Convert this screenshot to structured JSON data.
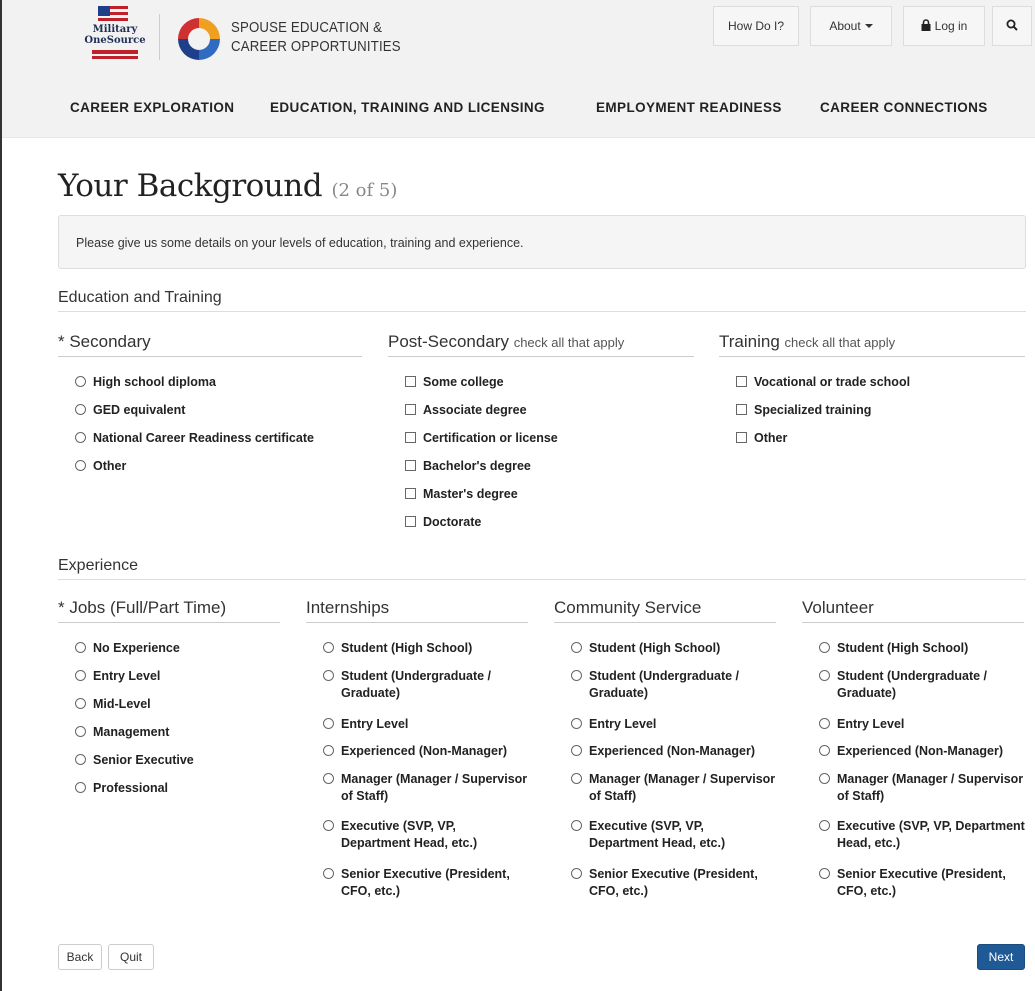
{
  "header": {
    "mos_logo_text": "Military OneSource",
    "seco_line1": "SPOUSE EDUCATION &",
    "seco_line2": "CAREER OPPORTUNITIES",
    "how_do_i": "How Do I?",
    "about": "About",
    "login": "Log in"
  },
  "nav": {
    "items": [
      "CAREER EXPLORATION",
      "EDUCATION, TRAINING AND LICENSING",
      "EMPLOYMENT READINESS",
      "CAREER CONNECTIONS"
    ]
  },
  "page": {
    "title": "Your Background",
    "step": "(2 of 5)",
    "intro": "Please give us some details on your levels of education, training and experience."
  },
  "education": {
    "heading": "Education and Training",
    "secondary": {
      "title": "* Secondary",
      "options": [
        "High school diploma",
        "GED equivalent",
        "National Career Readiness certificate",
        "Other"
      ]
    },
    "post_secondary": {
      "title": "Post-Secondary",
      "sub": "check all that apply",
      "options": [
        "Some college",
        "Associate degree",
        "Certification or license",
        "Bachelor's degree",
        "Master's degree",
        "Doctorate"
      ]
    },
    "training": {
      "title": "Training",
      "sub": "check all that apply",
      "options": [
        "Vocational or trade school",
        "Specialized training",
        "Other"
      ]
    }
  },
  "experience": {
    "heading": "Experience",
    "jobs": {
      "title": "* Jobs (Full/Part Time)",
      "options": [
        "No Experience",
        "Entry Level",
        "Mid-Level",
        "Management",
        "Senior Executive",
        "Professional"
      ]
    },
    "internships": {
      "title": "Internships",
      "options": [
        "Student (High School)",
        "Student (Undergraduate / Graduate)",
        "Entry Level",
        "Experienced (Non-Manager)",
        "Manager (Manager / Supervisor of Staff)",
        "Executive (SVP, VP, Department Head, etc.)",
        "Senior Executive (President, CFO, etc.)"
      ]
    },
    "community": {
      "title": "Community Service",
      "options": [
        "Student (High School)",
        "Student (Undergraduate / Graduate)",
        "Entry Level",
        "Experienced (Non-Manager)",
        "Manager (Manager / Supervisor of Staff)",
        "Executive (SVP, VP, Department Head, etc.)",
        "Senior Executive (President, CFO, etc.)"
      ]
    },
    "volunteer": {
      "title": "Volunteer",
      "options": [
        "Student (High School)",
        "Student (Undergraduate / Graduate)",
        "Entry Level",
        "Experienced (Non-Manager)",
        "Manager (Manager / Supervisor of Staff)",
        "Executive (SVP, VP, Department Head, etc.)",
        "Senior Executive (President, CFO, etc.)"
      ]
    }
  },
  "buttons": {
    "back": "Back",
    "quit": "Quit",
    "next": "Next"
  },
  "colors": {
    "primary": "#1f5a96",
    "nav_bg": "#f2f2f2"
  }
}
